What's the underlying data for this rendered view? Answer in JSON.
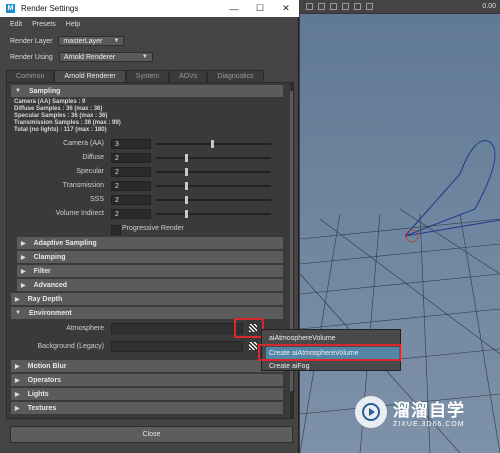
{
  "window": {
    "title": "Render Settings",
    "min": "—",
    "max": "☐",
    "close": "✕"
  },
  "menu": [
    "Edit",
    "Presets",
    "Help"
  ],
  "render_layer": {
    "label": "Render Layer",
    "value": "masterLayer"
  },
  "render_using": {
    "label": "Render Using",
    "value": "Arnold Renderer"
  },
  "tabs": [
    "Common",
    "Arnold Renderer",
    "System",
    "AOVs",
    "Diagnostics"
  ],
  "sampling": {
    "title": "Sampling",
    "info": [
      "Camera (AA) Samples : 9",
      "Diffuse Samples : 36 (max : 36)",
      "Specular Samples : 36 (max : 36)",
      "Transmission Samples : 36 (max : 99)",
      "Total (no lights) : 117 (max : 180)"
    ],
    "sliders": [
      {
        "label": "Camera (AA)",
        "value": "3",
        "level": 0.48
      },
      {
        "label": "Diffuse",
        "value": "2",
        "level": 0.25
      },
      {
        "label": "Specular",
        "value": "2",
        "level": 0.25
      },
      {
        "label": "Transmission",
        "value": "2",
        "level": 0.25
      },
      {
        "label": "SSS",
        "value": "2",
        "level": 0.25
      },
      {
        "label": "Volume Indirect",
        "value": "2",
        "level": 0.25
      }
    ],
    "progressive": "Progressive Render"
  },
  "subsections": [
    "Adaptive Sampling",
    "Clamping",
    "Filter",
    "Advanced"
  ],
  "ray_depth": "Ray Depth",
  "environment": {
    "title": "Environment",
    "atmosphere": "Atmosphere",
    "background": "Background (Legacy)"
  },
  "bottom_sections": [
    "Motion Blur",
    "Operators",
    "Lights",
    "Textures"
  ],
  "close": "Close",
  "popup": [
    "aiAtmosphereVolume",
    "Create aiAtmosphereVolume",
    "Create aiFog"
  ],
  "viewport": {
    "readout": "0.00"
  },
  "watermark": {
    "cn": "溜溜自学",
    "url": "ZIXUE.3D66.COM"
  }
}
